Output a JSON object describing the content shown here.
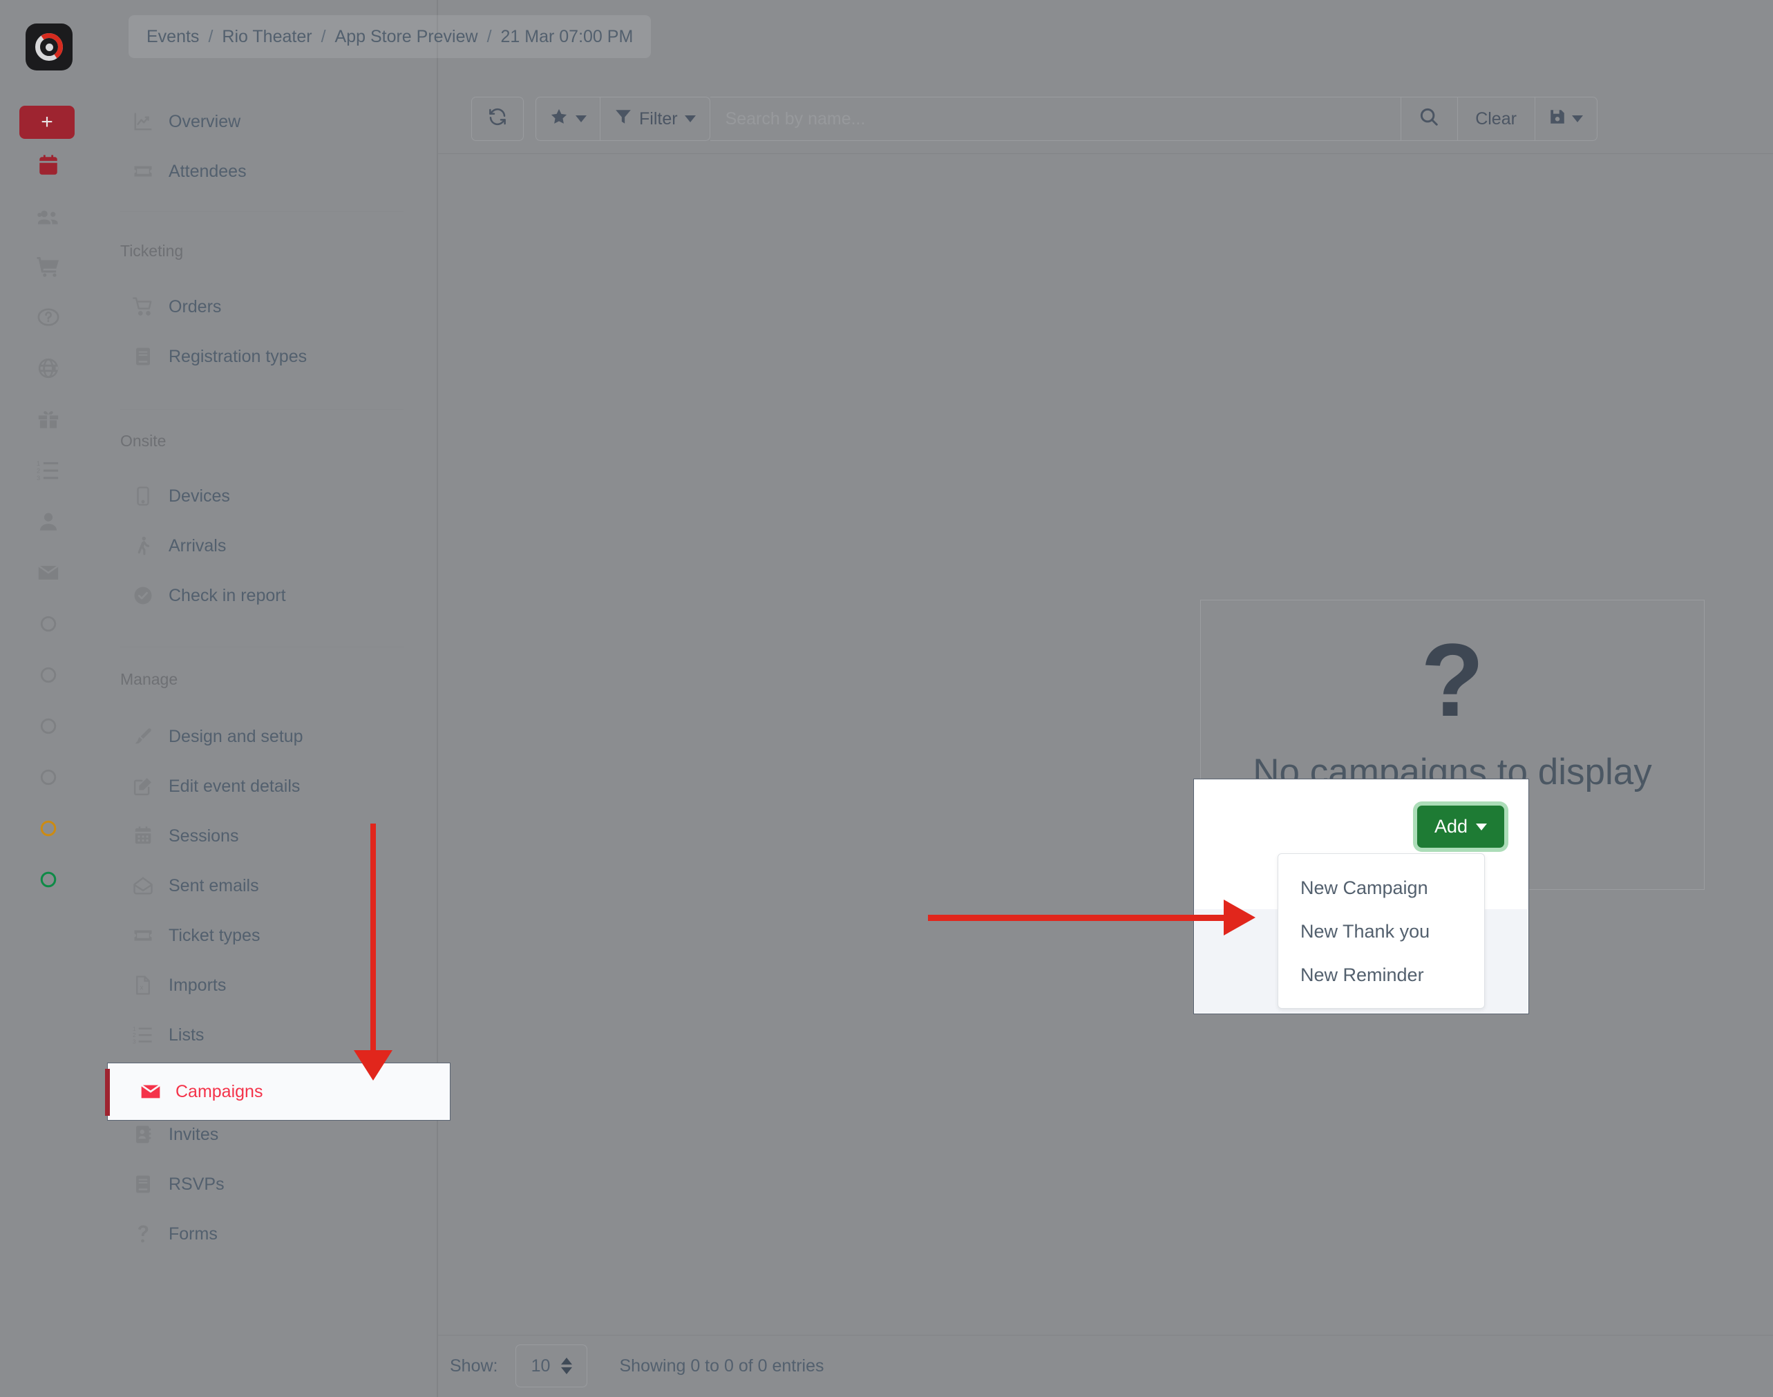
{
  "app": {
    "logo_icon": "gauge-logo-icon"
  },
  "breadcrumb": {
    "items": [
      "Events",
      "Rio Theater",
      "App Store Preview",
      "21 Mar 07:00 PM"
    ],
    "separator": "/"
  },
  "icon_rail": {
    "add_button_label": "+",
    "icons": [
      {
        "name": "calendar-icon",
        "color": "#9e2430"
      },
      {
        "name": "people-icon",
        "color": "#7e8083"
      },
      {
        "name": "cart-icon",
        "color": "#7e8083"
      },
      {
        "name": "help-circle-icon",
        "color": "#7e8083"
      },
      {
        "name": "globe-icon",
        "color": "#7e8083"
      },
      {
        "name": "gift-icon",
        "color": "#7e8083"
      },
      {
        "name": "numbered-list-icon",
        "color": "#7e8083"
      },
      {
        "name": "person-icon",
        "color": "#7e8083"
      },
      {
        "name": "envelope-icon",
        "color": "#7e8083"
      },
      {
        "name": "circle-icon",
        "color": "#7e8083"
      },
      {
        "name": "circle-icon",
        "color": "#7e8083"
      },
      {
        "name": "circle-icon",
        "color": "#7e8083"
      },
      {
        "name": "circle-icon",
        "color": "#7e8083"
      },
      {
        "name": "circle-icon",
        "color": "#cc8b13"
      },
      {
        "name": "circle-icon",
        "color": "#0f8a47"
      }
    ]
  },
  "sidebar": {
    "top_items": [
      {
        "label": "Overview",
        "icon": "chart-line-icon"
      },
      {
        "label": "Attendees",
        "icon": "ticket-icon"
      }
    ],
    "sections": [
      {
        "title": "Ticketing",
        "items": [
          {
            "label": "Orders",
            "icon": "cart-icon"
          },
          {
            "label": "Registration types",
            "icon": "book-icon"
          }
        ]
      },
      {
        "title": "Onsite",
        "items": [
          {
            "label": "Devices",
            "icon": "mobile-icon"
          },
          {
            "label": "Arrivals",
            "icon": "walking-icon"
          },
          {
            "label": "Check in report",
            "icon": "check-circle-icon"
          }
        ]
      },
      {
        "title": "Manage",
        "items": [
          {
            "label": "Design and setup",
            "icon": "paintbrush-icon"
          },
          {
            "label": "Edit event details",
            "icon": "edit-square-icon"
          },
          {
            "label": "Sessions",
            "icon": "calendar-icon"
          },
          {
            "label": "Sent emails",
            "icon": "open-envelope-icon"
          },
          {
            "label": "Ticket types",
            "icon": "ticket-icon"
          },
          {
            "label": "Imports",
            "icon": "excel-file-icon"
          },
          {
            "label": "Lists",
            "icon": "numbered-list-icon"
          },
          {
            "label": "Campaigns",
            "icon": "envelope-icon",
            "active": true
          },
          {
            "label": "Invites",
            "icon": "contact-card-icon"
          },
          {
            "label": "RSVPs",
            "icon": "book-icon"
          },
          {
            "label": "Forms",
            "icon": "question-mark-icon"
          }
        ]
      }
    ],
    "active_item": "Campaigns",
    "active_color": "#f4334a"
  },
  "toolbar": {
    "refresh_icon": "refresh-icon",
    "star_icon": "star-icon",
    "filter_label": "Filter",
    "filter_icon": "funnel-icon",
    "search_placeholder": "Search by name...",
    "search_value": "",
    "search_icon": "search-icon",
    "clear_label": "Clear",
    "save_icon": "floppy-disk-icon"
  },
  "empty_state": {
    "icon": "question-mark-icon",
    "glyph": "?",
    "message": "No campaigns to display"
  },
  "popup": {
    "add_button_label": "Add",
    "add_button_color": "#1e7b34",
    "menu_items": [
      "New Campaign",
      "New Thank you",
      "New Reminder"
    ]
  },
  "footer": {
    "show_label": "Show:",
    "page_size": "10",
    "entries_info": "Showing 0 to 0 of 0 entries"
  },
  "annotations": {
    "arrow_color": "#e1261c",
    "vertical_arrow_target": "Campaigns",
    "horizontal_arrow_target": "Add dropdown menu"
  }
}
